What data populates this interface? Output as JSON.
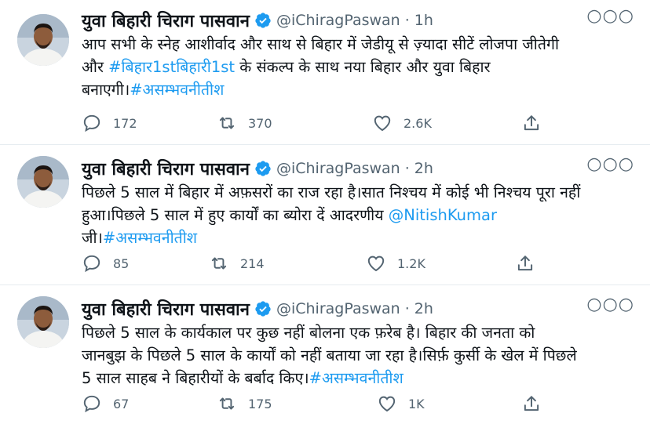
{
  "colors": {
    "accent": "#1d9bf0",
    "text": "#0f1419",
    "muted": "#536471",
    "divider": "#e6ecf0"
  },
  "tweets": [
    {
      "author_name": "युवा बिहारी चिराग पासवान",
      "handle": "@iChiragPaswan",
      "time": "1h",
      "verified_icon": "verified-badge-icon",
      "lines": [
        [
          {
            "t": "आप सभी के स्नेह आशीर्वाद और साथ से बिहार में जेडीयू से ज़्यादा सीटें लोजपा जीतेगी"
          }
        ],
        [
          {
            "t": "और "
          },
          {
            "t": "#बिहार1stबिहारी1st",
            "link": true
          },
          {
            "t": " के संकल्प के साथ नया बिहार और युवा बिहार"
          }
        ],
        [
          {
            "t": "बनाएगी।"
          },
          {
            "t": "#असम्भवनीतीश",
            "link": true
          }
        ]
      ],
      "replies": "172",
      "retweets": "370",
      "likes": "2.6K"
    },
    {
      "author_name": "युवा बिहारी चिराग पासवान",
      "handle": "@iChiragPaswan",
      "time": "2h",
      "verified_icon": "verified-badge-icon",
      "lines": [
        [
          {
            "t": "पिछले 5 साल में बिहार में अफ़सरों का राज रहा है।सात निश्चय में कोई भी निश्चय पूरा नहीं"
          }
        ],
        [
          {
            "t": "हुआ।पिछले 5 साल में हुए कार्यों का ब्योरा दें आदरणीय "
          },
          {
            "t": "@NitishKumar",
            "link": true
          }
        ],
        [
          {
            "t": "जी।"
          },
          {
            "t": "#असम्भवनीतीश",
            "link": true
          }
        ]
      ],
      "replies": "85",
      "retweets": "214",
      "likes": "1.2K"
    },
    {
      "author_name": "युवा बिहारी चिराग पासवान",
      "handle": "@iChiragPaswan",
      "time": "2h",
      "verified_icon": "verified-badge-icon",
      "lines": [
        [
          {
            "t": "पिछले 5 साल के कार्यकाल पर कुछ नहीं बोलना एक फ़रेब है। बिहार की जनता को"
          }
        ],
        [
          {
            "t": "जानबुझ के पिछले 5 साल के कार्यों को नहीं बताया जा रहा है।सिर्फ़ कुर्सी के खेल में पिछले"
          }
        ],
        [
          {
            "t": "5 साल साहब ने बिहारीयों के बर्बाद किए।"
          },
          {
            "t": "#असम्भवनीतीश",
            "link": true
          }
        ]
      ],
      "replies": "67",
      "retweets": "175",
      "likes": "1K"
    }
  ],
  "icons": {
    "more": "more-options-icon",
    "reply": "reply-icon",
    "retweet": "retweet-icon",
    "like": "like-icon",
    "share": "share-icon"
  },
  "more_glyph": "○○○"
}
